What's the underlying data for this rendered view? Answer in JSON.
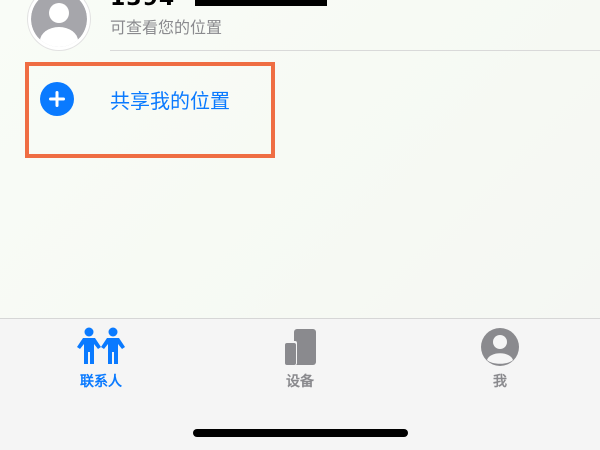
{
  "contact": {
    "name": "1394",
    "subtitle": "可查看您的位置"
  },
  "share": {
    "label": "共享我的位置"
  },
  "tabs": [
    {
      "label": "联系人",
      "icon": "people-icon",
      "active": true
    },
    {
      "label": "设备",
      "icon": "devices-icon",
      "active": false
    },
    {
      "label": "我",
      "icon": "me-icon",
      "active": false
    }
  ],
  "colors": {
    "accent": "#0a7aff",
    "highlight": "#ef6d43",
    "inactive": "#8a8a8e"
  }
}
